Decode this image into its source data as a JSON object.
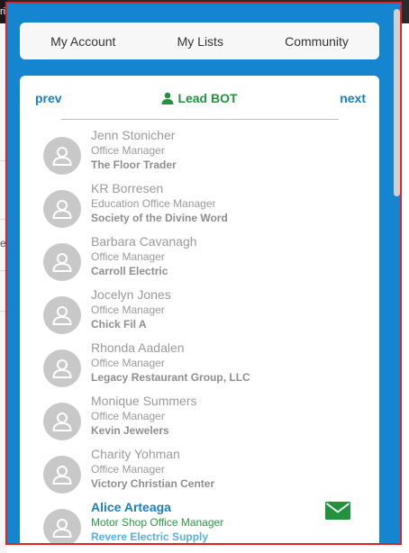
{
  "background": {
    "topbar_fragment": "ri",
    "side_letter": "e"
  },
  "nav": {
    "my_account": "My Account",
    "my_lists": "My Lists",
    "community": "Community"
  },
  "pager": {
    "prev": "prev",
    "next": "next",
    "title": "Lead BOT",
    "title_icon": "person-icon"
  },
  "contacts": [
    {
      "name": "Jenn Stonicher",
      "title": "Office Manager",
      "company": "The Floor Trader"
    },
    {
      "name": "KR Borresen",
      "title": "Education Office Manager",
      "company": "Society of the Divine Word"
    },
    {
      "name": "Barbara Cavanagh",
      "title": "Office Manager",
      "company": "Carroll Electric"
    },
    {
      "name": "Jocelyn Jones",
      "title": "Office Manager",
      "company": "Chick Fil A"
    },
    {
      "name": "Rhonda Aadalen",
      "title": "Office Manager",
      "company": "Legacy Restaurant Group, LLC"
    },
    {
      "name": "Monique Summers",
      "title": "Office Manager",
      "company": "Kevin Jewelers"
    },
    {
      "name": "Charity Yohman",
      "title": "Office Manager",
      "company": "Victory Christian Center"
    },
    {
      "name": "Alice Arteaga",
      "title": "Motor Shop Office Manager",
      "company": "Revere Electric Supply",
      "active": true,
      "icon": "envelope-icon"
    }
  ],
  "colors": {
    "panel_blue": "#1585d0",
    "link_blue": "#1a7fc4",
    "accent_green": "#22923e",
    "frame_red": "#e02424"
  }
}
